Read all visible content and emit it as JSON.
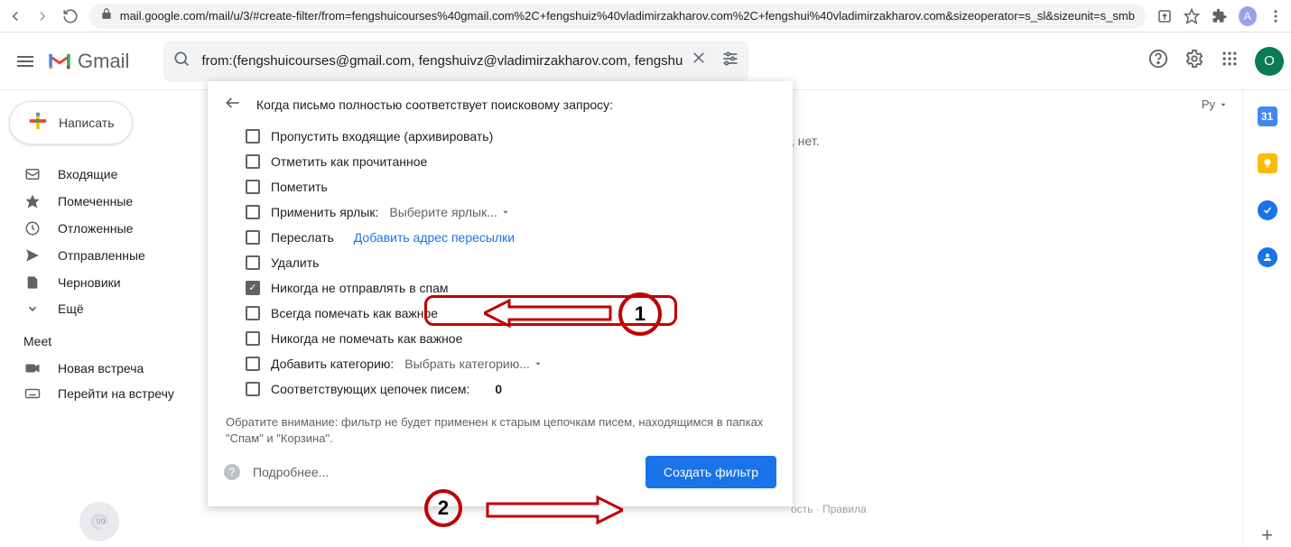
{
  "browser": {
    "url": "mail.google.com/mail/u/3/#create-filter/from=fengshuicourses%40gmail.com%2C+fengshuiz%40vladimirzakharov.com%2C+fengshui%40vladimirzakharov.com&sizeoperator=s_sl&sizeunit=s_smb",
    "avatar_letter": "A"
  },
  "header": {
    "app_name": "Gmail",
    "search_value": "from:(fengshuicourses@gmail.com, fengshuivz@vladimirzakharov.com, fengshu",
    "account_letter": "O"
  },
  "sidebar": {
    "compose_label": "Написать",
    "items": [
      {
        "label": "Входящие"
      },
      {
        "label": "Помеченные"
      },
      {
        "label": "Отложенные"
      },
      {
        "label": "Отправленные"
      },
      {
        "label": "Черновики"
      },
      {
        "label": "Ещё"
      }
    ],
    "meet_title": "Meet",
    "meet_items": [
      {
        "label": "Новая встреча"
      },
      {
        "label": "Перейти на встречу"
      }
    ]
  },
  "toolbar": {
    "lang": "Ру"
  },
  "bg_hint": ", нет.",
  "footer_legal": "ость · Правила",
  "filter": {
    "title": "Когда письмо полностью соответствует поисковому запросу:",
    "opts": {
      "skip_inbox": "Пропустить входящие (архивировать)",
      "mark_read": "Отметить как прочитанное",
      "star": "Пометить",
      "apply_label": "Применить ярлык:",
      "apply_label_select": "Выберите ярлык...",
      "forward": "Переслать",
      "forward_link": "Добавить адрес пересылки",
      "delete": "Удалить",
      "never_spam": "Никогда не отправлять в спам",
      "always_important": "Всегда помечать как важное",
      "never_important": "Никогда не помечать как важное",
      "category": "Добавить категорию:",
      "category_select": "Выбрать категорию...",
      "matching": "Соответствующих цепочек писем:",
      "matching_count": "0"
    },
    "note": "Обратите внимание: фильтр не будет применен к старым цепочкам писем, находящимся в папках \"Спам\" и \"Корзина\".",
    "more": "Подробнее...",
    "create": "Создать фильтр"
  },
  "annotations": {
    "n1": "1",
    "n2": "2"
  }
}
